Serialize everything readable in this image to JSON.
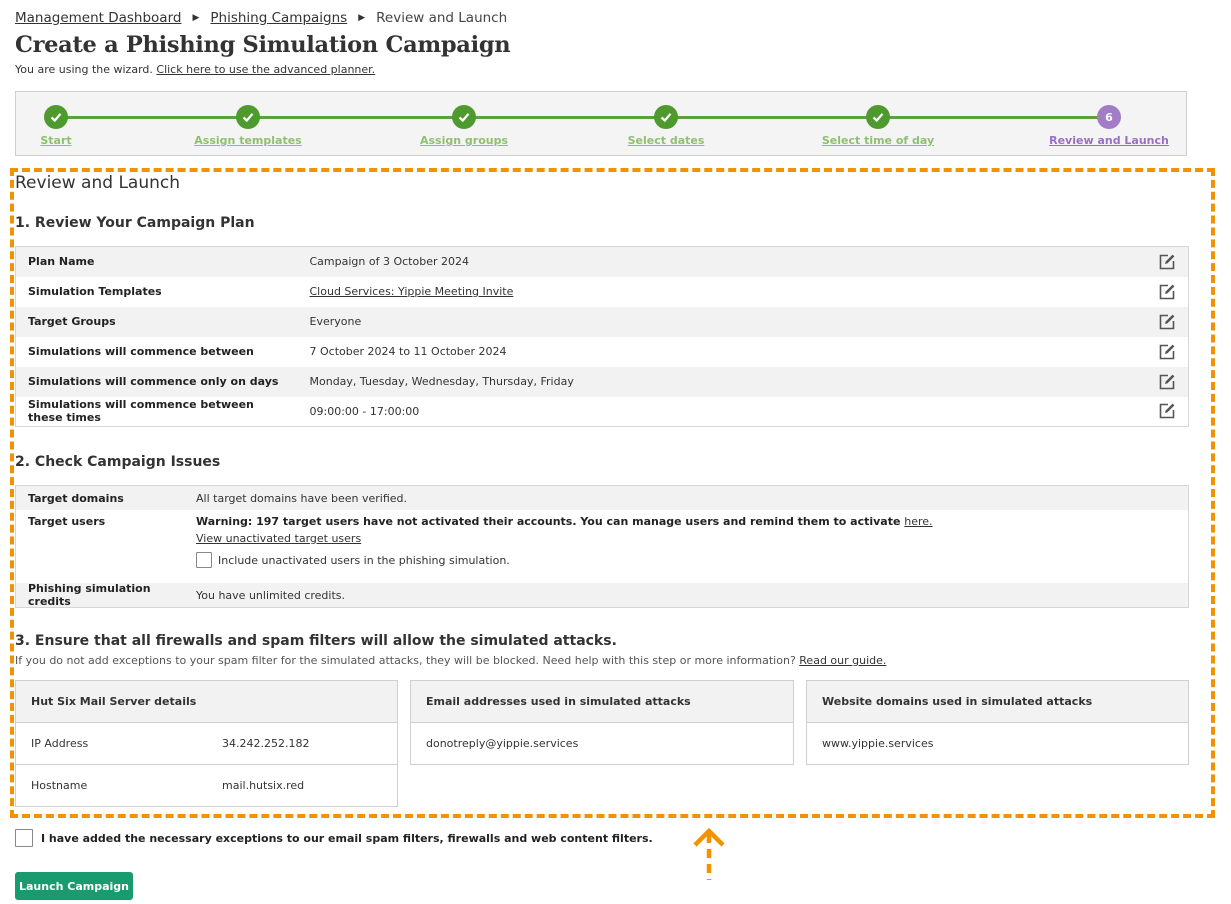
{
  "breadcrumb": {
    "items": [
      "Management Dashboard",
      "Phishing Campaigns",
      "Review and Launch"
    ]
  },
  "page": {
    "title": "Create a Phishing Simulation Campaign",
    "wizard_note": "You are using the wizard.",
    "advanced_link": "Click here to use the advanced planner."
  },
  "stepper": {
    "steps": [
      {
        "label": "Start",
        "state": "complete"
      },
      {
        "label": "Assign templates",
        "state": "complete"
      },
      {
        "label": "Assign groups",
        "state": "complete"
      },
      {
        "label": "Select dates",
        "state": "complete"
      },
      {
        "label": "Select time of day",
        "state": "complete"
      },
      {
        "label": "Review and Launch",
        "state": "current",
        "number": "6"
      }
    ],
    "complete_color": "#4e9a2e",
    "current_color": "#a27cc7"
  },
  "review": {
    "section_title": "Review and Launch",
    "plan_heading": "1. Review Your Campaign Plan",
    "plan_rows": [
      {
        "key": "Plan Name",
        "value": "Campaign of 3 October 2024"
      },
      {
        "key": "Simulation Templates",
        "value": "Cloud Services: Yippie Meeting Invite"
      },
      {
        "key": "Target Groups",
        "value": "Everyone"
      },
      {
        "key": "Simulations will commence between",
        "value": "7 October 2024 to 11 October 2024"
      },
      {
        "key": "Simulations will commence only on days",
        "value": "Monday, Tuesday, Wednesday, Thursday, Friday"
      },
      {
        "key": "Simulations will commence between these times",
        "value": "09:00:00 - 17:00:00"
      }
    ],
    "edit_icon": "edit-pencil-icon"
  },
  "issues": {
    "heading": "2. Check Campaign Issues",
    "target_domains_label": "Target domains",
    "target_domains_value": "All target domains have been verified.",
    "target_users_label": "Target users",
    "target_users_warning": "Warning: 197 target users have not activated their accounts. You can manage users and remind them to activate ",
    "target_users_here": "here.",
    "view_unactivated": "View unactivated target users",
    "include_unactivated": "Include unactivated users in the phishing simulation.",
    "credits_label": "Phishing simulation credits",
    "credits_value": "You have unlimited credits."
  },
  "firewall": {
    "heading": "3. Ensure that all firewalls and spam filters will allow the simulated attacks.",
    "description": "If you do not add exceptions to your spam filter for the simulated attacks, they will be blocked. Need help with this step or more information?",
    "guide_link": "Read our guide.",
    "mail_server": {
      "title": "Hut Six Mail Server details",
      "ip_label": "IP Address",
      "ip_value": "34.242.252.182",
      "host_label": "Hostname",
      "host_value": "mail.hutsix.red"
    },
    "emails": {
      "title": "Email addresses used in simulated attacks",
      "value": "donotreply@yippie.services"
    },
    "domains": {
      "title": "Website domains used in simulated attacks",
      "value": "www.yippie.services"
    }
  },
  "confirm": {
    "label": "I have added the necessary exceptions to our email spam filters, firewalls and web content filters."
  },
  "launch": {
    "label": "Launch Campaign",
    "color": "#1a9a6f"
  },
  "annotation": {
    "color": "#f39200",
    "arrow_icon": "up-arrow-icon"
  }
}
